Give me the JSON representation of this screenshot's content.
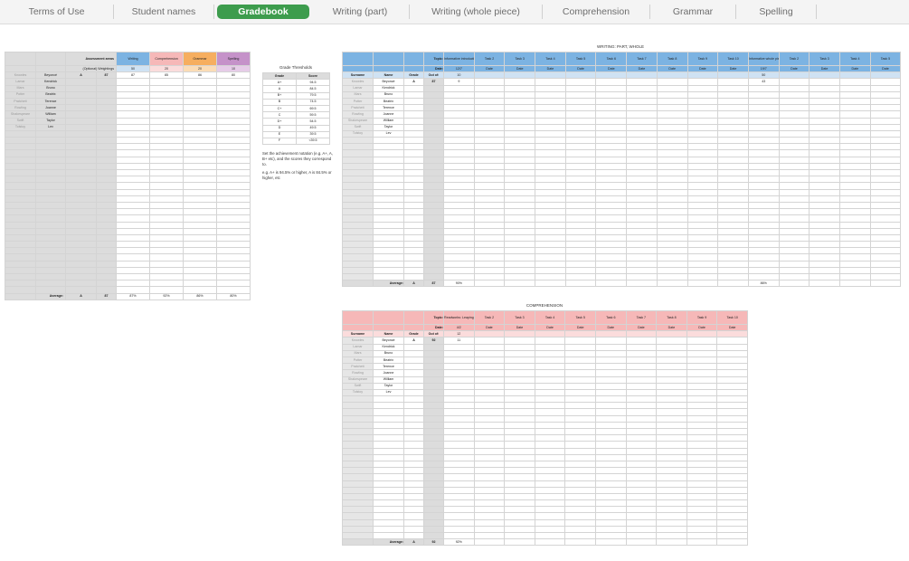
{
  "tabs": [
    "Terms of Use",
    "Student names",
    "Gradebook",
    "Writing (part)",
    "Writing (whole piece)",
    "Comprehension",
    "Grammar",
    "Spelling"
  ],
  "active_tab": 2,
  "students": [
    {
      "surname": "Knowles",
      "name": "Beyoncé"
    },
    {
      "surname": "Lamar",
      "name": "Kendrick"
    },
    {
      "surname": "Mars",
      "name": "Bruno"
    },
    {
      "surname": "Potter",
      "name": "Beatrix"
    },
    {
      "surname": "Pratchett",
      "name": "Terence"
    },
    {
      "surname": "Rowling",
      "name": "Joanne"
    },
    {
      "surname": "Shakespeare",
      "name": "William"
    },
    {
      "surname": "Swift",
      "name": "Taylor"
    },
    {
      "surname": "Tolstoy",
      "name": "Lev"
    }
  ],
  "gradebook": {
    "header_assessment": "Assessment areas",
    "header_weightings": "(Optional) Weightings",
    "areas": [
      {
        "name": "Writing",
        "weight": "50",
        "first_score": "87",
        "average": "87%"
      },
      {
        "name": "Comprehension",
        "weight": "20",
        "first_score": "85",
        "average": "92%"
      },
      {
        "name": "Grammar",
        "weight": "20",
        "first_score": "86",
        "average": "86%"
      },
      {
        "name": "Spelling",
        "weight": "10",
        "first_score": "80",
        "average": "80%"
      }
    ],
    "first_row_grade": "A",
    "first_row_score": "87",
    "average_label": "Average:",
    "average_grade": "A",
    "average_score": "87"
  },
  "thresholds": {
    "title": "Grade Thresholds",
    "col_grade": "Grade",
    "col_score": "Score",
    "rows": [
      [
        "A+",
        "94.5"
      ],
      [
        "A",
        "84.5"
      ],
      [
        "B+",
        "79.5"
      ],
      [
        "B",
        "74.5"
      ],
      [
        "C+",
        "69.5"
      ],
      [
        "C",
        "59.5"
      ],
      [
        "D+",
        "54.5"
      ],
      [
        "D",
        "49.5"
      ],
      [
        "E",
        "39.5"
      ],
      [
        "F",
        "<39.5"
      ]
    ],
    "note1": "Set the achievement notation (e.g. A+, A, B+ etc), and the scores they correspond to.",
    "note2": "e.g. A+ is 94.5% or higher, A is 84.5% or higher, etc"
  },
  "writing": {
    "title": "WRITING: PART, WHOLE",
    "topic_label": "Topic:",
    "date_label": "Date:",
    "outof_label": "Out of:",
    "surname_label": "Surname",
    "name_label": "Name",
    "grade_label": "Grade",
    "part_tasks": [
      "Informative introductions",
      "Task 2",
      "Task 3",
      "Task 4",
      "Task 5",
      "Task 6",
      "Task 7",
      "Task 8",
      "Task 9",
      "Task 10"
    ],
    "part_first_date": "12/7",
    "part_outof": "10",
    "part_first_score": "9",
    "whole_tasks": [
      "Informative whole piece",
      "Task 2",
      "Task 3",
      "Task 4",
      "Task 5"
    ],
    "whole_first_date": "19/7",
    "whole_outof": "50",
    "whole_first_score": "43",
    "date_placeholder": "Date",
    "first_grade": "A",
    "first_outof": "87",
    "average_label": "Average:",
    "average_grade": "A",
    "average_score": "87",
    "part_average": "90%",
    "whole_average": "86%"
  },
  "comprehension": {
    "title": "COMPREHENSION",
    "topic_label": "Topic:",
    "date_label": "Date:",
    "outof_label": "Out of:",
    "surname_label": "Surname",
    "name_label": "Name",
    "grade_label": "Grade",
    "tasks": [
      "Readworks: Leaping Lizards",
      "Task 2",
      "Task 3",
      "Task 4",
      "Task 5",
      "Task 6",
      "Task 7",
      "Task 8",
      "Task 9",
      "Task 10"
    ],
    "first_date": "4/2",
    "outof": "12",
    "first_score": "11",
    "date_placeholder": "Date",
    "first_grade": "A",
    "first_outof": "92",
    "average_label": "Average:",
    "average_grade": "A",
    "average_score": "92",
    "task_average": "92%"
  }
}
